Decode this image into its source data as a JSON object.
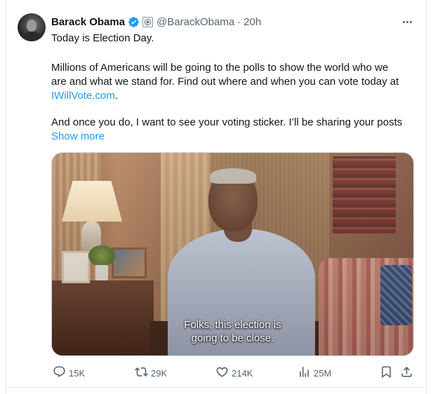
{
  "author": {
    "name": "Barack Obama",
    "handle": "@BarackObama",
    "separator": "·",
    "time": "20h"
  },
  "tweet": {
    "line1": "Today is Election Day.",
    "line2": "Millions of Americans will be going to the polls to show the world who we",
    "line3": "are and what we stand for. Find out where and when you can vote today at",
    "link": "IWillVote.com",
    "link_suffix": ".",
    "line4": "And once you do, I want to see your voting sticker. I’ll be sharing your posts",
    "show_more": "Show more"
  },
  "media": {
    "caption_line1": "Folks, this election is",
    "caption_line2": "going to be close."
  },
  "actions": {
    "replies": "15K",
    "reposts": "29K",
    "likes": "214K",
    "views": "25M"
  },
  "colors": {
    "link": "#1d9bf0",
    "secondary_text": "#536471",
    "verified": "#1d9bf0"
  }
}
